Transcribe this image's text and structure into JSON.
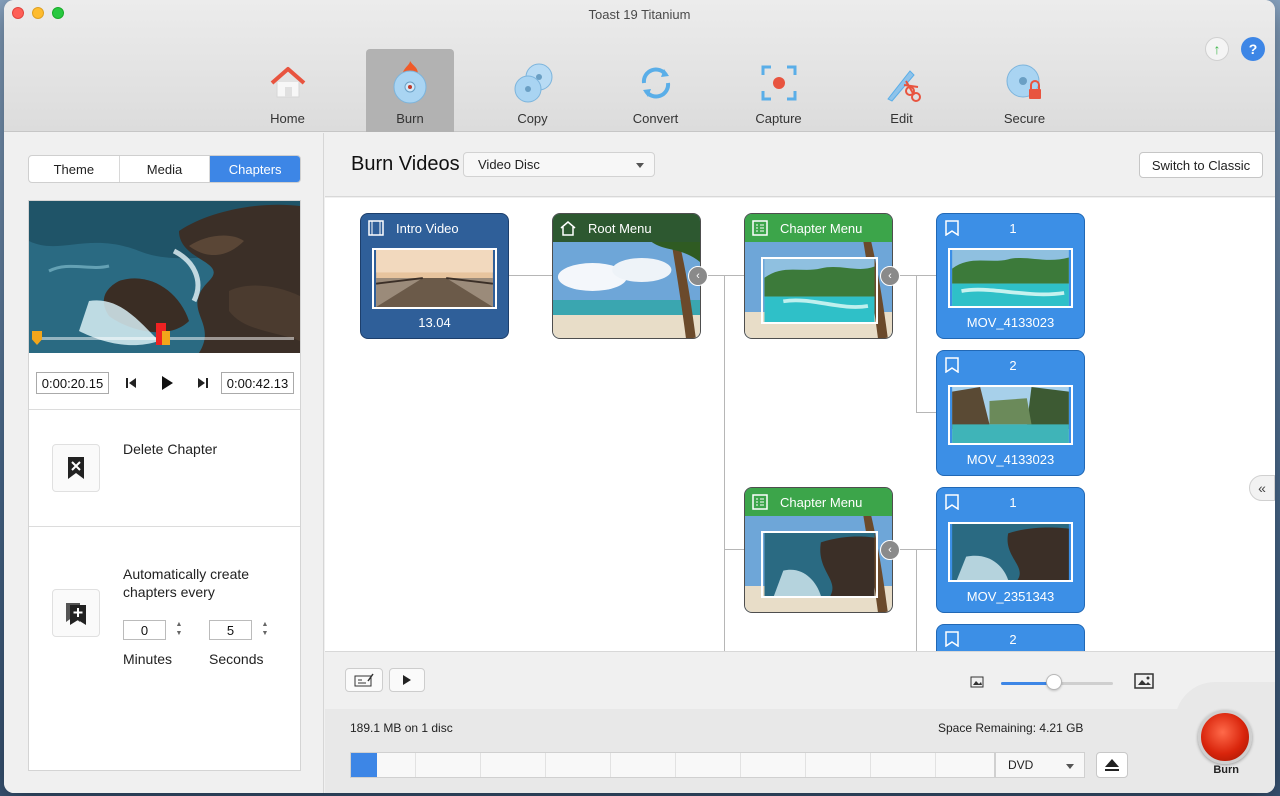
{
  "window": {
    "title": "Toast 19 Titanium"
  },
  "nav": [
    {
      "label": "Home",
      "icon": "home-icon",
      "active": false
    },
    {
      "label": "Burn",
      "icon": "burn-disc-icon",
      "active": true
    },
    {
      "label": "Copy",
      "icon": "copy-discs-icon",
      "active": false
    },
    {
      "label": "Convert",
      "icon": "convert-arrows-icon",
      "active": false
    },
    {
      "label": "Capture",
      "icon": "capture-target-icon",
      "active": false
    },
    {
      "label": "Edit",
      "icon": "edit-pen-scissors-icon",
      "active": false
    },
    {
      "label": "Secure",
      "icon": "secure-disc-lock-icon",
      "active": false
    }
  ],
  "top_actions": {
    "upload": "↑",
    "help": "?"
  },
  "sidebar": {
    "tabs": [
      "Theme",
      "Media",
      "Chapters"
    ],
    "active_tab": "Chapters",
    "start_time": "0:00:20.15",
    "end_time": "0:00:42.13",
    "delete_chapter_label": "Delete Chapter",
    "auto_create_label": "Automatically create chapters every",
    "minutes_value": "0",
    "seconds_value": "5",
    "minutes_label": "Minutes",
    "seconds_label": "Seconds"
  },
  "main": {
    "title": "Burn Videos",
    "disc_type": "Video Disc",
    "switch_classic_label": "Switch to Classic"
  },
  "nodes": {
    "intro": {
      "title": "Intro Video",
      "caption": "13.04"
    },
    "root": {
      "title": "Root Menu"
    },
    "chapter_menu_1": {
      "title": "Chapter Menu"
    },
    "chapter_menu_2": {
      "title": "Chapter Menu"
    },
    "chapters": [
      {
        "number": "1",
        "caption": "MOV_4133023"
      },
      {
        "number": "2",
        "caption": "MOV_4133023"
      },
      {
        "number": "1",
        "caption": "MOV_2351343"
      },
      {
        "number": "2",
        "caption": ""
      }
    ]
  },
  "status": {
    "size_text": "189.1 MB on 1 disc",
    "space_remaining": "Space Remaining: 4.21 GB",
    "media": "DVD",
    "capacity_fraction": 0.04,
    "burn_label": "Burn"
  },
  "zoom": {
    "level_fraction": 0.47
  },
  "colors": {
    "accent": "#3d86e6",
    "chapter_node": "#3c8fe6",
    "intro_node": "#2f5f99",
    "menu_header": "#3ca54a",
    "burn_red": "#d9250c"
  }
}
